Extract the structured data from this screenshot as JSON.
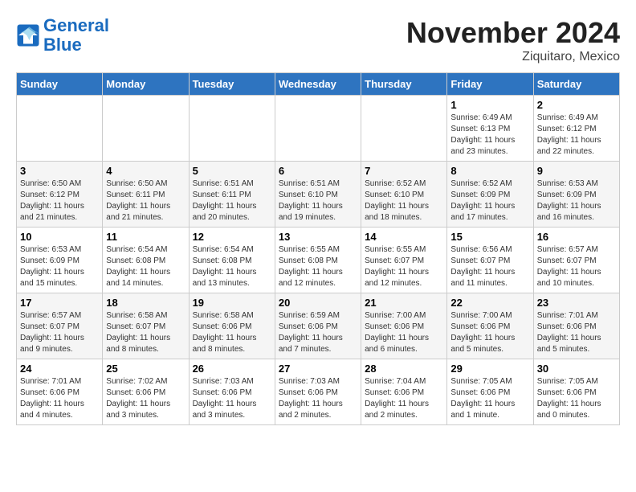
{
  "logo": {
    "line1": "General",
    "line2": "Blue"
  },
  "title": "November 2024",
  "location": "Ziquitaro, Mexico",
  "days_header": [
    "Sunday",
    "Monday",
    "Tuesday",
    "Wednesday",
    "Thursday",
    "Friday",
    "Saturday"
  ],
  "weeks": [
    [
      {
        "day": "",
        "info": ""
      },
      {
        "day": "",
        "info": ""
      },
      {
        "day": "",
        "info": ""
      },
      {
        "day": "",
        "info": ""
      },
      {
        "day": "",
        "info": ""
      },
      {
        "day": "1",
        "info": "Sunrise: 6:49 AM\nSunset: 6:13 PM\nDaylight: 11 hours and 23 minutes."
      },
      {
        "day": "2",
        "info": "Sunrise: 6:49 AM\nSunset: 6:12 PM\nDaylight: 11 hours and 22 minutes."
      }
    ],
    [
      {
        "day": "3",
        "info": "Sunrise: 6:50 AM\nSunset: 6:12 PM\nDaylight: 11 hours and 21 minutes."
      },
      {
        "day": "4",
        "info": "Sunrise: 6:50 AM\nSunset: 6:11 PM\nDaylight: 11 hours and 21 minutes."
      },
      {
        "day": "5",
        "info": "Sunrise: 6:51 AM\nSunset: 6:11 PM\nDaylight: 11 hours and 20 minutes."
      },
      {
        "day": "6",
        "info": "Sunrise: 6:51 AM\nSunset: 6:10 PM\nDaylight: 11 hours and 19 minutes."
      },
      {
        "day": "7",
        "info": "Sunrise: 6:52 AM\nSunset: 6:10 PM\nDaylight: 11 hours and 18 minutes."
      },
      {
        "day": "8",
        "info": "Sunrise: 6:52 AM\nSunset: 6:09 PM\nDaylight: 11 hours and 17 minutes."
      },
      {
        "day": "9",
        "info": "Sunrise: 6:53 AM\nSunset: 6:09 PM\nDaylight: 11 hours and 16 minutes."
      }
    ],
    [
      {
        "day": "10",
        "info": "Sunrise: 6:53 AM\nSunset: 6:09 PM\nDaylight: 11 hours and 15 minutes."
      },
      {
        "day": "11",
        "info": "Sunrise: 6:54 AM\nSunset: 6:08 PM\nDaylight: 11 hours and 14 minutes."
      },
      {
        "day": "12",
        "info": "Sunrise: 6:54 AM\nSunset: 6:08 PM\nDaylight: 11 hours and 13 minutes."
      },
      {
        "day": "13",
        "info": "Sunrise: 6:55 AM\nSunset: 6:08 PM\nDaylight: 11 hours and 12 minutes."
      },
      {
        "day": "14",
        "info": "Sunrise: 6:55 AM\nSunset: 6:07 PM\nDaylight: 11 hours and 12 minutes."
      },
      {
        "day": "15",
        "info": "Sunrise: 6:56 AM\nSunset: 6:07 PM\nDaylight: 11 hours and 11 minutes."
      },
      {
        "day": "16",
        "info": "Sunrise: 6:57 AM\nSunset: 6:07 PM\nDaylight: 11 hours and 10 minutes."
      }
    ],
    [
      {
        "day": "17",
        "info": "Sunrise: 6:57 AM\nSunset: 6:07 PM\nDaylight: 11 hours and 9 minutes."
      },
      {
        "day": "18",
        "info": "Sunrise: 6:58 AM\nSunset: 6:07 PM\nDaylight: 11 hours and 8 minutes."
      },
      {
        "day": "19",
        "info": "Sunrise: 6:58 AM\nSunset: 6:06 PM\nDaylight: 11 hours and 8 minutes."
      },
      {
        "day": "20",
        "info": "Sunrise: 6:59 AM\nSunset: 6:06 PM\nDaylight: 11 hours and 7 minutes."
      },
      {
        "day": "21",
        "info": "Sunrise: 7:00 AM\nSunset: 6:06 PM\nDaylight: 11 hours and 6 minutes."
      },
      {
        "day": "22",
        "info": "Sunrise: 7:00 AM\nSunset: 6:06 PM\nDaylight: 11 hours and 5 minutes."
      },
      {
        "day": "23",
        "info": "Sunrise: 7:01 AM\nSunset: 6:06 PM\nDaylight: 11 hours and 5 minutes."
      }
    ],
    [
      {
        "day": "24",
        "info": "Sunrise: 7:01 AM\nSunset: 6:06 PM\nDaylight: 11 hours and 4 minutes."
      },
      {
        "day": "25",
        "info": "Sunrise: 7:02 AM\nSunset: 6:06 PM\nDaylight: 11 hours and 3 minutes."
      },
      {
        "day": "26",
        "info": "Sunrise: 7:03 AM\nSunset: 6:06 PM\nDaylight: 11 hours and 3 minutes."
      },
      {
        "day": "27",
        "info": "Sunrise: 7:03 AM\nSunset: 6:06 PM\nDaylight: 11 hours and 2 minutes."
      },
      {
        "day": "28",
        "info": "Sunrise: 7:04 AM\nSunset: 6:06 PM\nDaylight: 11 hours and 2 minutes."
      },
      {
        "day": "29",
        "info": "Sunrise: 7:05 AM\nSunset: 6:06 PM\nDaylight: 11 hours and 1 minute."
      },
      {
        "day": "30",
        "info": "Sunrise: 7:05 AM\nSunset: 6:06 PM\nDaylight: 11 hours and 0 minutes."
      }
    ]
  ]
}
